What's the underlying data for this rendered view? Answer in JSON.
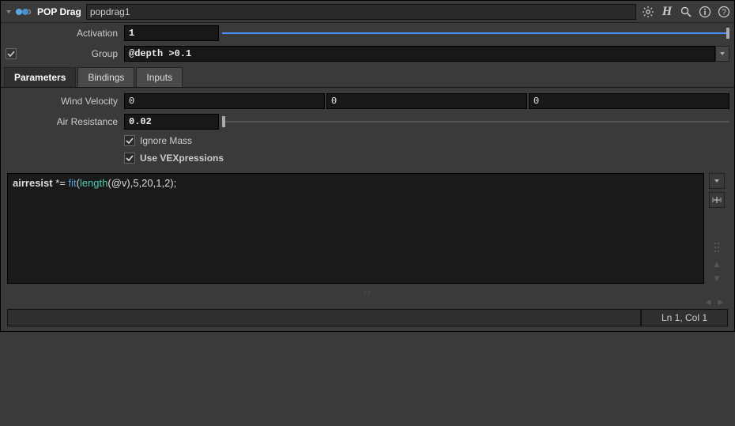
{
  "header": {
    "node_type": "POP Drag",
    "node_name": "popdrag1"
  },
  "activation": {
    "label": "Activation",
    "value": "1"
  },
  "group": {
    "label": "Group",
    "value": "@depth >0.1"
  },
  "tabs": [
    "Parameters",
    "Bindings",
    "Inputs"
  ],
  "active_tab": 0,
  "wind_velocity": {
    "label": "Wind Velocity",
    "x": "0",
    "y": "0",
    "z": "0"
  },
  "air_resistance": {
    "label": "Air Resistance",
    "value": "0.02"
  },
  "ignore_mass": {
    "label": "Ignore Mass",
    "checked": true
  },
  "use_vex": {
    "label": "Use VEXpressions",
    "checked": true
  },
  "vex_code_plain": "airresist *= fit(length(@v),5,20,1,2);",
  "status": {
    "cursor": "Ln 1, Col 1"
  }
}
